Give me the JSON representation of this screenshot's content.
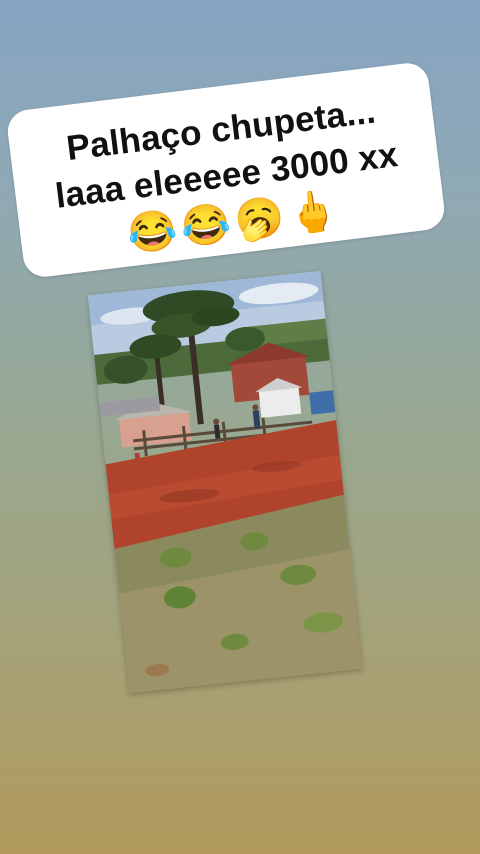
{
  "story": {
    "caption": {
      "line1": "Palhaço chupeta...",
      "line2": "laaa eleeeee 3000 xx",
      "emojis": [
        "😂",
        "😂",
        "🥱",
        "🖕"
      ]
    },
    "photo": {
      "description_icon": "photo-image-icon"
    }
  },
  "colors": {
    "background_top": "#86a4c2",
    "background_bottom": "#b19a5c",
    "sticker": "#ffffff",
    "caption_text": "#111111"
  }
}
